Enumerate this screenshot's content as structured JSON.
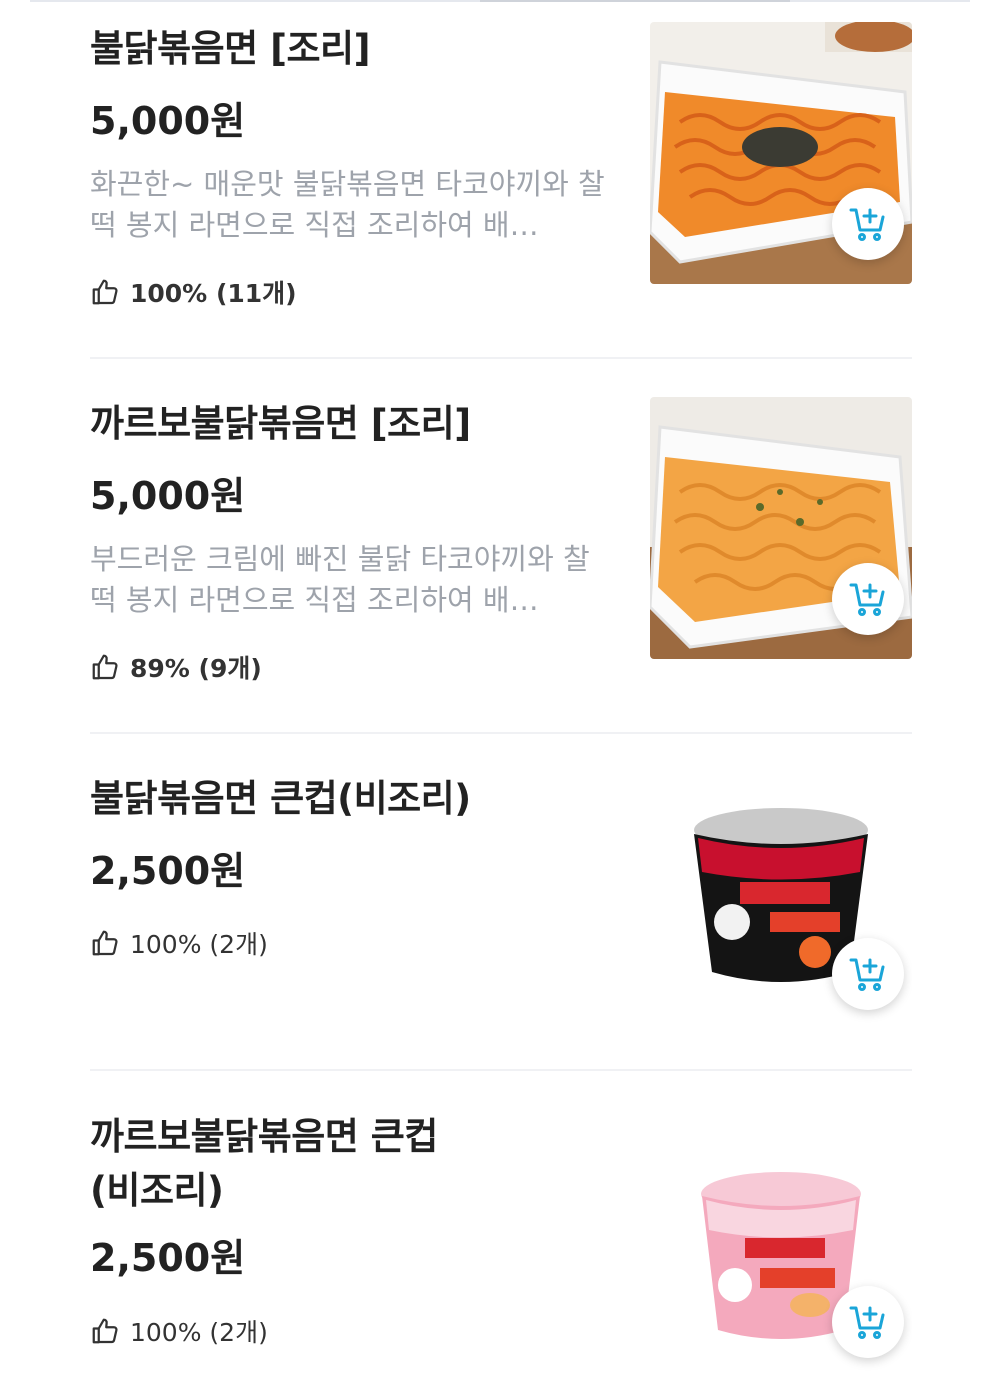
{
  "colors": {
    "accent": "#1aa5d8",
    "muted_text": "#9ea3ab",
    "divider": "#f0f1f4"
  },
  "items": [
    {
      "name": "불닭볶음면 [조리]",
      "price": "5,000원",
      "description": "화끈한~ 매운맛 불닭볶음면 타코야끼와 찰떡 봉지 라면으로 직접 조리하여 배…",
      "rating": "100% (11개)",
      "thumb_icon": "cooked-noodles-tray-image",
      "cart_icon": "add-to-cart-icon"
    },
    {
      "name": "까르보불닭볶음면 [조리]",
      "price": "5,000원",
      "description": "부드러운 크림에 빠진 불닭 타코야끼와 찰떡 봉지 라면으로 직접 조리하여 배…",
      "rating": "89% (9개)",
      "thumb_icon": "cooked-carbonara-noodles-tray-image",
      "cart_icon": "add-to-cart-icon"
    },
    {
      "name": "불닭볶음면 큰컵(비조리)",
      "price": "2,500원",
      "rating": "100% (2개)",
      "thumb_icon": "black-noodle-cup-image",
      "cart_icon": "add-to-cart-icon"
    },
    {
      "name": "까르보불닭볶음면 큰컵 (비조리)",
      "price": "2,500원",
      "rating": "100% (2개)",
      "thumb_icon": "pink-noodle-cup-image",
      "cart_icon": "add-to-cart-icon"
    }
  ]
}
